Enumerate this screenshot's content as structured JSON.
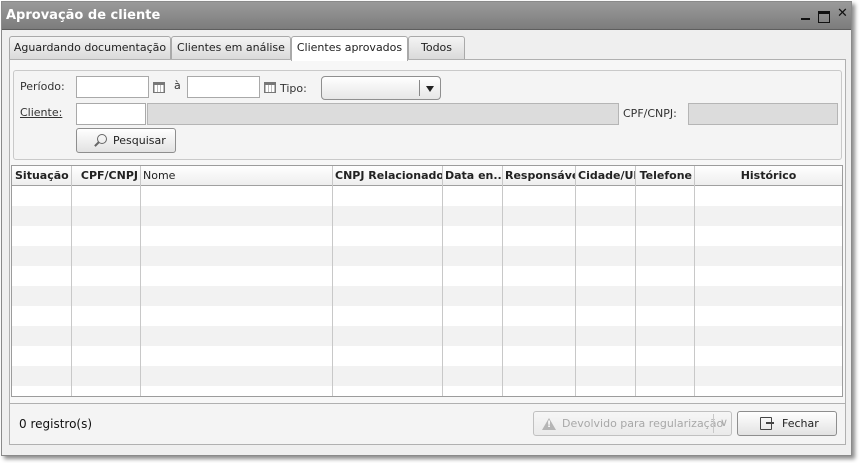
{
  "window": {
    "title": "Aprovação de cliente"
  },
  "tabs": [
    {
      "label": "Aguardando documentação"
    },
    {
      "label": "Clientes em análise"
    },
    {
      "label": "Clientes aprovados",
      "active": true
    },
    {
      "label": "Todos"
    }
  ],
  "filter": {
    "periodo_label": "Período:",
    "ate_label": "à",
    "tipo_label": "Tipo:",
    "tipo_value": "",
    "cliente_label": "Cliente:",
    "cpf_label": "CPF/CNPJ:",
    "periodo_inicio": "",
    "periodo_fim": "",
    "cliente_codigo": "",
    "cliente_nome": "",
    "cpf_value": "",
    "pesquisar_label": "Pesquisar"
  },
  "table": {
    "columns": [
      "Situação",
      "CPF/CNPJ",
      "Nome",
      "CNPJ Relacionado",
      "Data en...",
      "Responsável",
      "Cidade/UF",
      "Telefone",
      "Histórico"
    ],
    "rows": []
  },
  "footer": {
    "count": "0 registro(s)",
    "devolvido_label": "Devolvido para regularização",
    "fechar_label": "Fechar"
  },
  "icons": [
    "minimize-icon",
    "maximize-icon",
    "close-icon",
    "calendar-icon",
    "chevron-down-icon",
    "search-icon",
    "warning-icon",
    "exit-icon"
  ]
}
